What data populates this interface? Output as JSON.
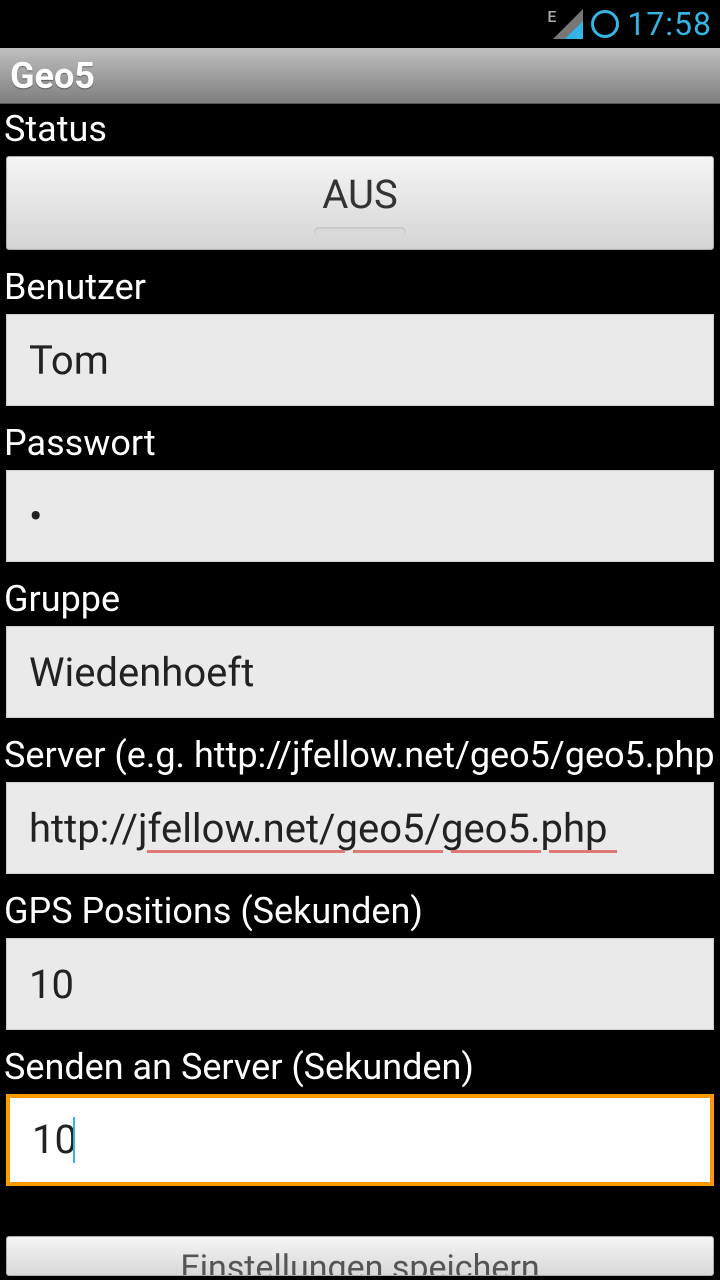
{
  "statusbar": {
    "network_type": "E",
    "time": "17:58"
  },
  "app": {
    "title": "Geo5"
  },
  "form": {
    "status_label": "Status",
    "status_value": "AUS",
    "user_label": "Benutzer",
    "user_value": "Tom",
    "password_label": "Passwort",
    "password_value": "•",
    "group_label": "Gruppe",
    "group_value": "Wiedenhoeft",
    "server_label": "Server (e.g. http://jfellow.net/geo5/geo5.php",
    "server_value": "http://jfellow.net/geo5/geo5.php",
    "gps_label": "GPS Positions (Sekunden)",
    "gps_value": "10",
    "send_label": "Senden an Server (Sekunden)",
    "send_value": "10",
    "save_button": "Einstellungen speichern"
  }
}
